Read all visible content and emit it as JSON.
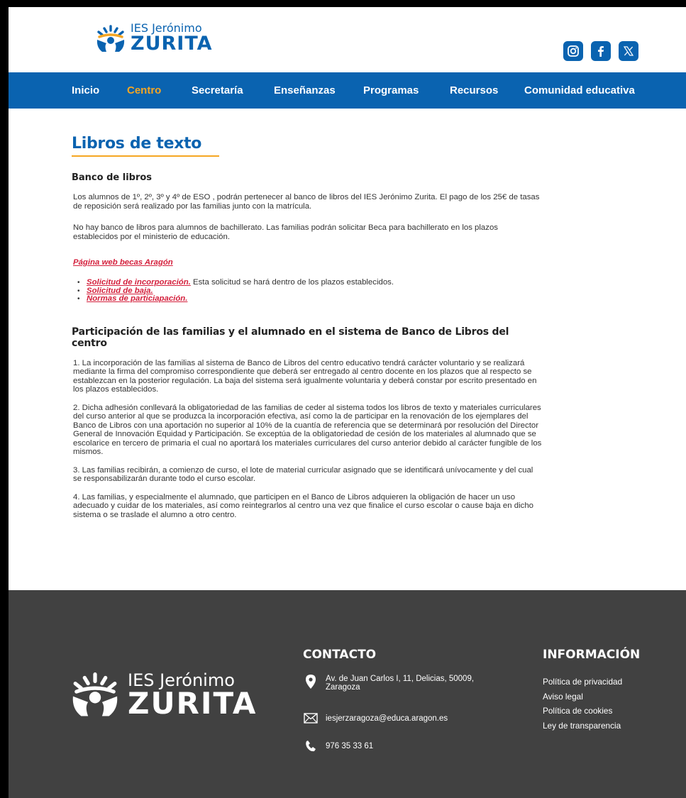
{
  "header": {
    "logo": {
      "small": "IES Jerónimo",
      "big": "ZURITA"
    },
    "socials": [
      {
        "name": "instagram-icon"
      },
      {
        "name": "facebook-icon"
      },
      {
        "name": "x-icon"
      }
    ]
  },
  "nav": {
    "items": [
      "Inicio",
      "Centro",
      "Secretaría",
      "Enseñanzas",
      "Programas",
      "Recursos",
      "Comunidad educativa"
    ],
    "active": "Centro"
  },
  "main": {
    "title": "Libros de texto",
    "subhead": "Banco de libros",
    "intro": [
      "Los alumnos de 1º, 2º, 3º y 4º de ESO , podrán pertenecer al banco de libros del IES Jerónimo Zurita.  El pago de los 25€ de tasas de reposición será realizado por las familias junto con la matrícula.",
      "No hay banco de libros para alumnos de  bachillerato. Las familias podrán solicitar Beca para bachillerato en los plazos establecidos por el ministerio de educación."
    ],
    "becas_link": "Página web becas Aragón",
    "links": [
      {
        "label": "Solicitud de incorporación.",
        "note": " Esta solicitud se hará dentro de los plazos establecidos."
      },
      {
        "label": "Solicitud de baja.",
        "note": ""
      },
      {
        "label": "Normas de particiapación.",
        "note": ""
      }
    ],
    "section_title": "Participación de las familias y el alumnado en el sistema de Banco de Libros del centro",
    "rules": [
      "1. La incorporación de las familias al sistema de Banco de Libros del centro educativo tendrá carácter voluntario y se realizará mediante la firma del compromiso correspondiente que deberá ser entregado al centro docente en los plazos que al respecto se establezcan en la posterior regulación. La baja del sistema será igualmente voluntaria y deberá constar por escrito presentado en los plazos establecidos.",
      "2. Dicha adhesión conllevará la obligatoriedad de las familias de ceder al sistema todos los libros de texto y materiales curriculares del curso anterior al que se produzca la incorporación efectiva, así como la de participar en la renovación de los ejemplares del Banco de Libros con una aportación no superior al 10% de la cuantía de referencia que se determinará por resolución del Director General de Innovación Equidad y Participación. Se exceptúa de la obligatoriedad de cesión de los materiales al alumnado que se escolarice en tercero de primaria el cual no aportará los materiales curriculares del curso anterior debido al carácter fungible de los mismos.",
      "3. Las familias recibirán, a comienzo de curso, el lote de material curricular asignado que se identificará unívocamente y del cual se responsabilizarán durante todo el curso escolar.",
      "4. Las familias, y especialmente el alumnado, que participen en el Banco de Libros adquieren la obligación de hacer un uso adecuado y cuidar de los materiales, así como reintegrarlos al centro una vez que finalice el curso escolar o cause baja en dicho sistema o se traslade el alumno a otro centro."
    ]
  },
  "footer": {
    "logo": {
      "small": "IES Jerónimo",
      "big": "ZURITA"
    },
    "contact_title": "CONTACTO",
    "address": "Av. de Juan Carlos I, 11, Delicias, 50009, Zaragoza",
    "email": "iesjerzaragoza@educa.aragon.es",
    "phone": "976 35 33 61",
    "info_title": "INFORMACIÓN",
    "info_links": [
      "Política de privacidad",
      "Aviso legal",
      "Política de cookies",
      "Ley de transparencia"
    ]
  },
  "colors": {
    "brand_blue": "#0a63b0",
    "accent_orange": "#f5a623",
    "link_red": "#d4213d",
    "footer_bg": "#414141"
  }
}
